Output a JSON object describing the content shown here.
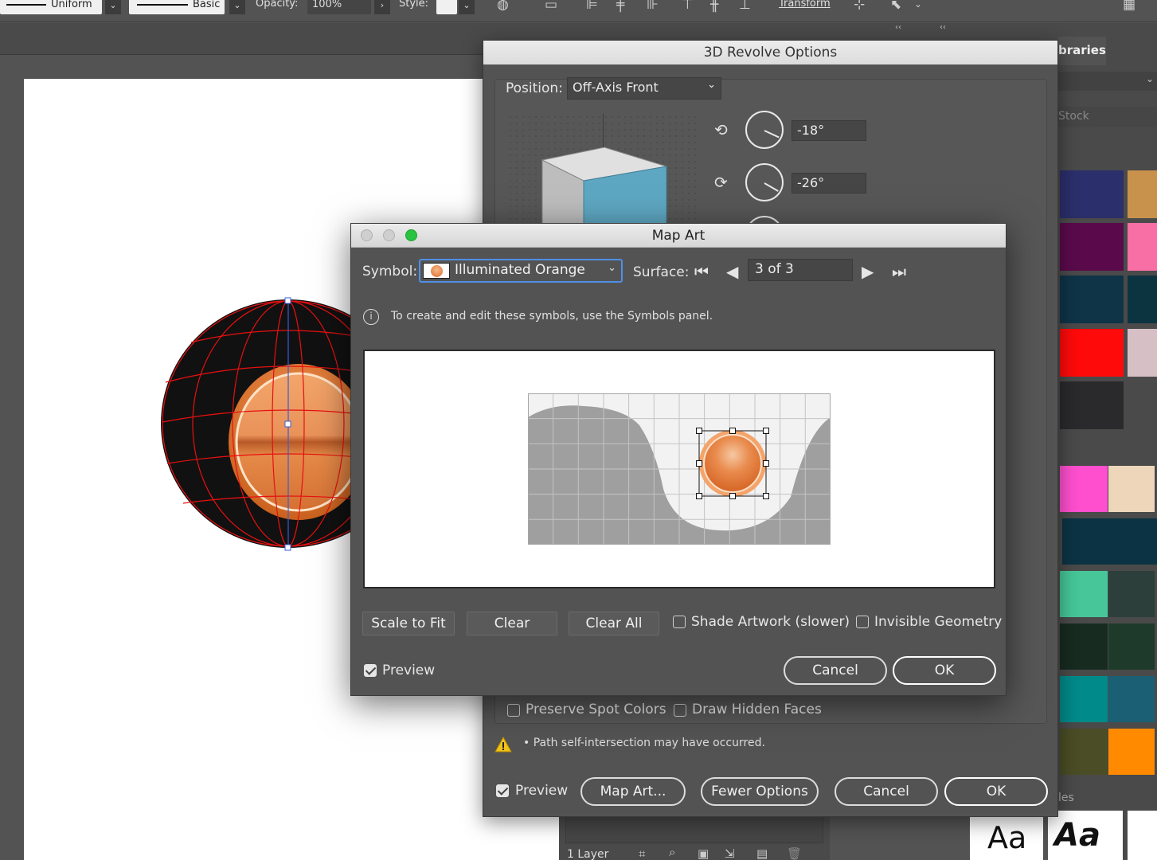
{
  "control_bar": {
    "stroke_profile": "Uniform",
    "brush": "Basic",
    "opacity_label": "Opacity:",
    "opacity_value": "100%",
    "style_label": "Style:",
    "transform_label": "Transform"
  },
  "panels": {
    "libraries_tab": "braries",
    "stock_search": "Stock",
    "layers_count": "1 Layer",
    "styles_label": "les",
    "char_style_sample_1": "Aa",
    "char_style_sample_2": "Aa"
  },
  "revolve_dialog": {
    "title": "3D Revolve Options",
    "position_label": "Position:",
    "position_value": "Off-Axis Front",
    "rotate_x": "-18°",
    "rotate_y": "-26°",
    "preserve_spot_colors": "Preserve Spot Colors",
    "draw_hidden_faces": "Draw Hidden Faces",
    "warning": "• Path self-intersection may have occurred.",
    "preview_label": "Preview",
    "map_art_button": "Map Art...",
    "fewer_options_button": "Fewer Options",
    "cancel_button": "Cancel",
    "ok_button": "OK"
  },
  "map_art_dialog": {
    "title": "Map Art",
    "symbol_label": "Symbol:",
    "symbol_value": "Illuminated Orange",
    "surface_label": "Surface:",
    "surface_value": "3 of 3",
    "info_text": "To create and edit these symbols, use the Symbols panel.",
    "scale_to_fit": "Scale to Fit",
    "clear": "Clear",
    "clear_all": "Clear All",
    "shade_artwork": "Shade Artwork (slower)",
    "invisible_geometry": "Invisible Geometry",
    "preview_label": "Preview",
    "cancel_button": "Cancel",
    "ok_button": "OK",
    "preview_checked": true,
    "shade_checked": false,
    "invisible_checked": false
  },
  "swatch_colors": [
    "#2b2f6b",
    "#c8924d",
    "#5a0a4b",
    "#f76fa5",
    "#0f3447",
    "#0c3340",
    "#ff0a0a",
    "#d6c0c6",
    "#2a2a2d",
    "#ff4fcf",
    "#eed6bb",
    "#0c3344",
    "#46c699",
    "#2d3f3b",
    "#172b21",
    "#1d3a2a",
    "#008a8a",
    "#1a5f73",
    "#4a4d25",
    "#ff8a00"
  ]
}
